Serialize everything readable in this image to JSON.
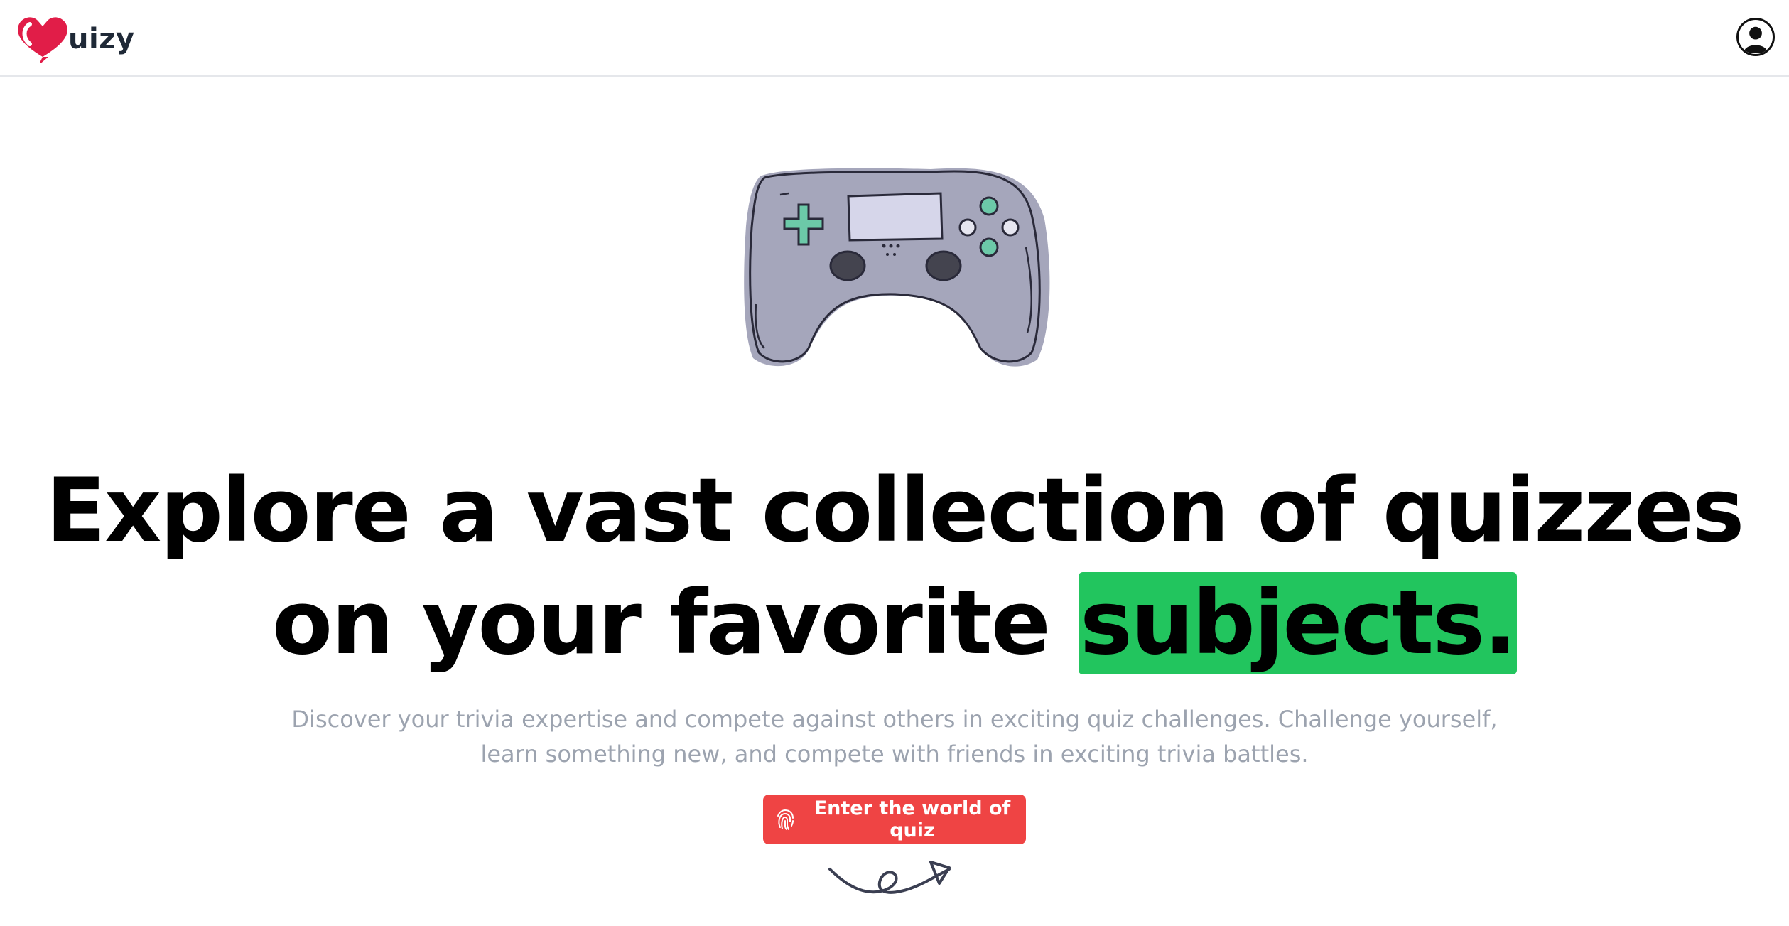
{
  "app": {
    "logo_text": "uizy",
    "logo_color": "#e11d48",
    "logo_icon": "heart-q-logo-icon",
    "profile_icon": "user-silhouette-icon"
  },
  "hero": {
    "illustration": "game-controller-icon",
    "headline_line1": "Explore a vast collection of quizzes",
    "headline_line2_prefix": "on your favorite ",
    "headline_highlight": "subjects.",
    "highlight_color": "#22c55e",
    "subtext": "Discover your trivia expertise and compete against others in exciting quiz challenges. Challenge yourself, learn something new, and compete with friends in exciting trivia battles.",
    "cta_label": "Enter the world of quiz",
    "cta_icon": "fingerprint-icon",
    "cta_color": "#ef4444",
    "decoration": "curly-arrow-icon"
  }
}
